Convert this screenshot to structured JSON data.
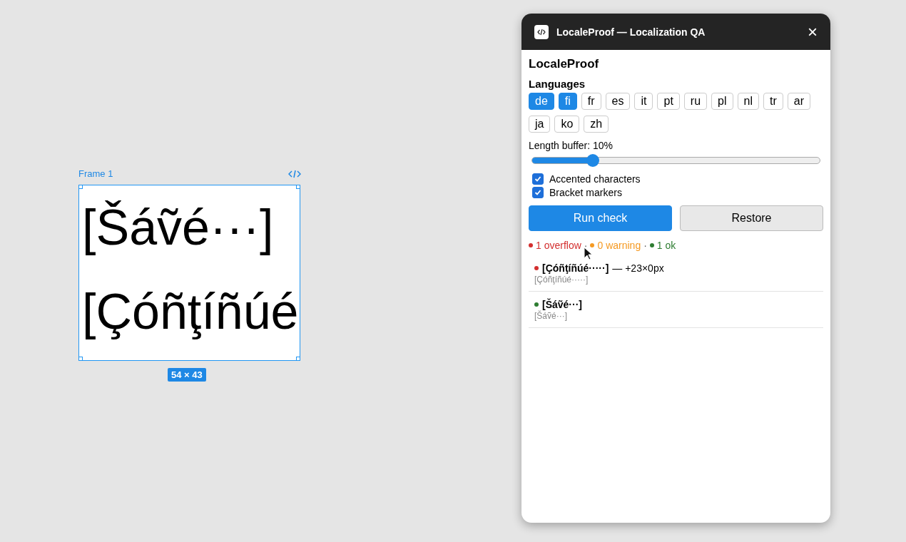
{
  "canvas": {
    "frame": {
      "label": "Frame 1",
      "lines": [
        "[Šáṽé···]",
        "[Çóñţíñúé"
      ],
      "size": "54 × 43"
    }
  },
  "window": {
    "title": "LocaleProof — Localization QA",
    "close": "×"
  },
  "plugin": {
    "heading": "LocaleProof",
    "languages_label": "Languages",
    "languages": [
      {
        "label": "de",
        "selected": true
      },
      {
        "label": "fi",
        "selected": true
      },
      {
        "label": "fr",
        "selected": false
      },
      {
        "label": "es",
        "selected": false
      },
      {
        "label": "it",
        "selected": false
      },
      {
        "label": "pt",
        "selected": false
      },
      {
        "label": "ru",
        "selected": false
      },
      {
        "label": "pl",
        "selected": false
      },
      {
        "label": "nl",
        "selected": false
      },
      {
        "label": "tr",
        "selected": false
      },
      {
        "label": "ar",
        "selected": false
      },
      {
        "label": "ja",
        "selected": false
      },
      {
        "label": "ko",
        "selected": false
      },
      {
        "label": "zh",
        "selected": false
      }
    ],
    "buffer": {
      "label": "Length buffer: 10%",
      "level": 0.21
    },
    "options": [
      {
        "label": "Accented characters",
        "checked": true
      },
      {
        "label": "Bracket markers",
        "checked": true
      }
    ],
    "buttons": [
      {
        "label": "Run check",
        "kind": "primary"
      },
      {
        "label": "Restore",
        "kind": "secondary"
      }
    ],
    "summary_separator": "·",
    "summary": [
      {
        "label": "1 overflow",
        "color": "#d32f2f"
      },
      {
        "label": "0 warning",
        "color": "#f59a23"
      },
      {
        "label": "1 ok",
        "color": "#2e7d32"
      }
    ],
    "results": [
      {
        "title": "[Çóñţíñúé·····]",
        "detail": "— +23×0px",
        "original": "[Çóñţíñúé·····]",
        "color": "#d32f2f"
      },
      {
        "title": "[Šáṽé···]",
        "original": "[Šáṽé···]",
        "color": "#2e7d32"
      }
    ]
  }
}
